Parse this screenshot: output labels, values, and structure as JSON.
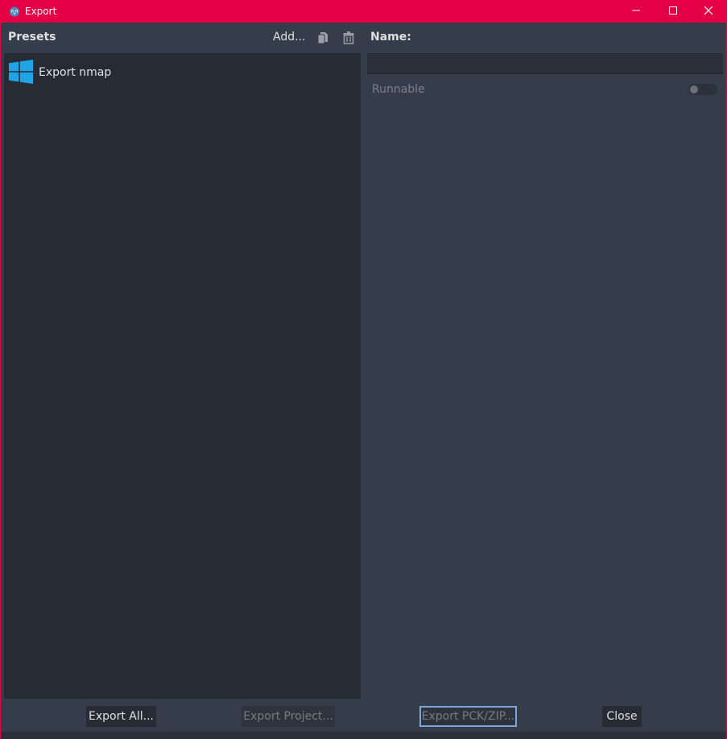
{
  "window": {
    "title": "Export",
    "controls": [
      "minimize-icon",
      "maximize-icon",
      "close-icon"
    ]
  },
  "presets": {
    "label": "Presets",
    "add_label": "Add...",
    "items": [
      {
        "name": "Export nmap",
        "icon": "windows-logo-icon"
      }
    ]
  },
  "details": {
    "name_label": "Name:",
    "name_value": "",
    "runnable_label": "Runnable",
    "runnable_enabled": false
  },
  "buttons": {
    "export_all": "Export All...",
    "export_project": "Export Project...",
    "export_pck": "Export PCK/ZIP...",
    "close": "Close"
  },
  "colors": {
    "titlebar": "#e40044",
    "panel_bg": "#363d4a",
    "list_bg": "#262b34",
    "focus_border": "#7aa6dc",
    "windows_blue": "#1fa4e6"
  }
}
